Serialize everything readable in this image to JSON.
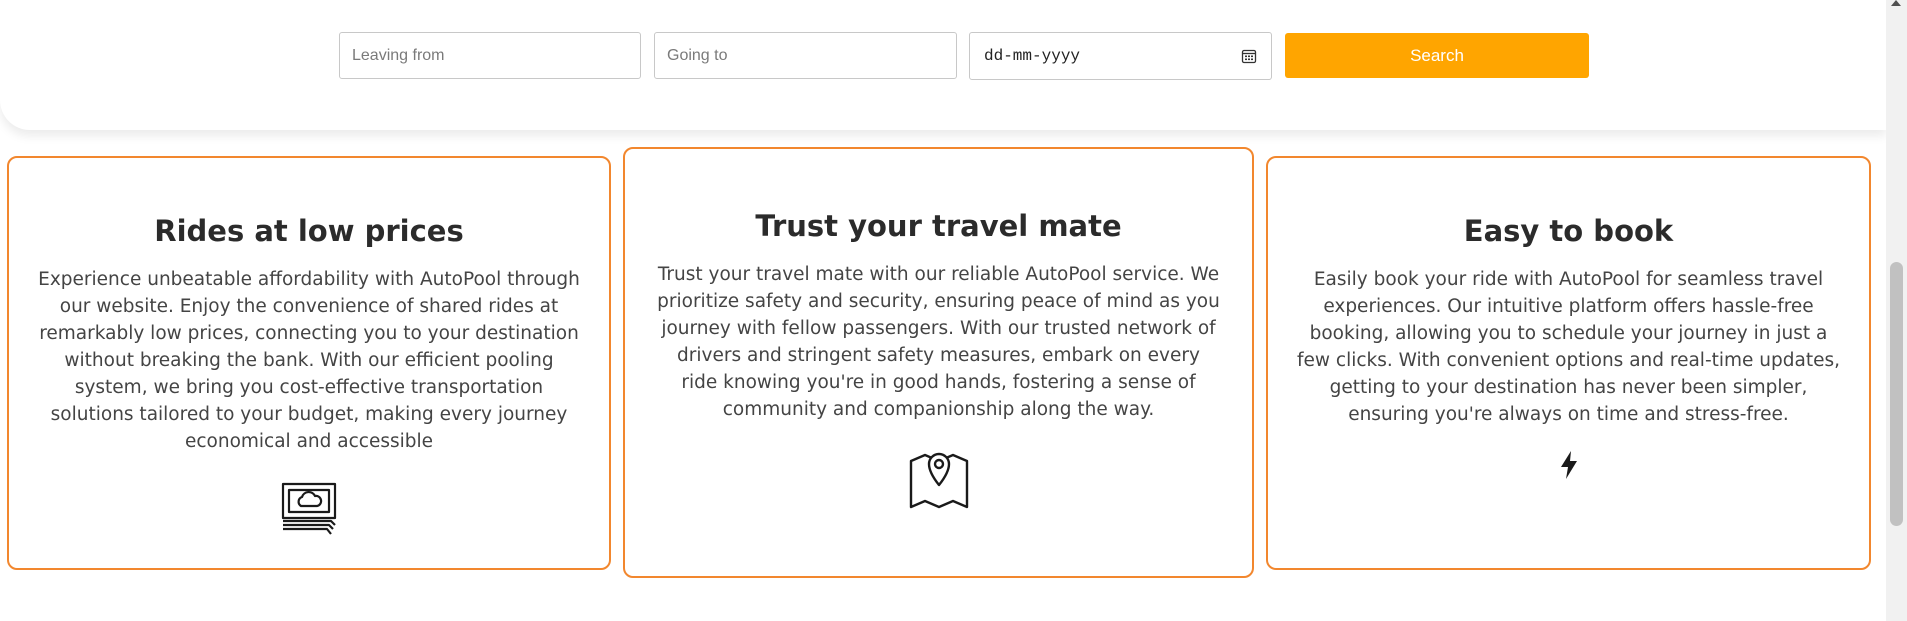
{
  "search": {
    "leaving_placeholder": "Leaving from",
    "going_placeholder": "Going to",
    "date_value": "dd-mm-yyyy",
    "button_label": "Search",
    "button_color": "#ffa500"
  },
  "features": [
    {
      "title": "Rides at low prices",
      "text": "Experience unbeatable affordability with AutoPool through our website. Enjoy the convenience of shared rides at remarkably low prices, connecting you to your destination without breaking the bank. With our efficient pooling system, we bring you cost-effective transportation solutions tailored to your budget, making every journey economical and accessible",
      "icon": "money-icon"
    },
    {
      "title": "Trust your travel mate",
      "text": "Trust your travel mate with our reliable AutoPool service. We prioritize safety and security, ensuring peace of mind as you journey with fellow passengers. With our trusted network of drivers and stringent safety measures, embark on every ride knowing you're in good hands, fostering a sense of community and companionship along the way.",
      "icon": "map-pin-icon"
    },
    {
      "title": "Easy to book",
      "text": "Easily book your ride with AutoPool for seamless travel experiences. Our intuitive platform offers hassle-free booking, allowing you to schedule your journey in just a few clicks. With convenient options and real-time updates, getting to your destination has never been simpler, ensuring you're always on time and stress-free.",
      "icon": "lightning-icon"
    }
  ],
  "colors": {
    "card_border": "#f2872e",
    "accent": "#ffa500"
  }
}
